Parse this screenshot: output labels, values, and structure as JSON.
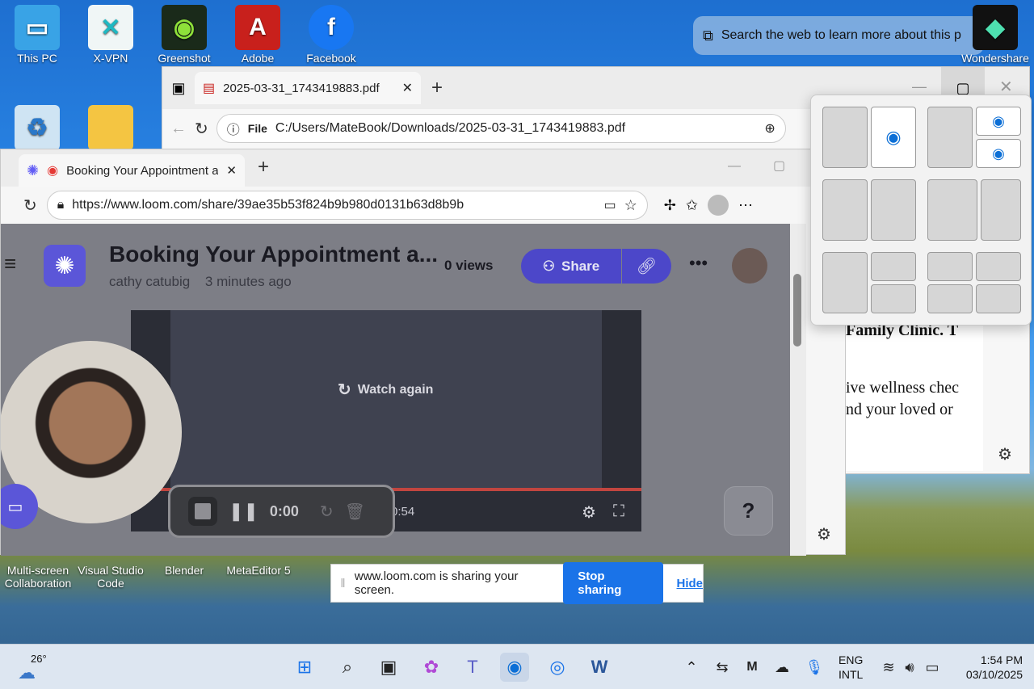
{
  "desktop_icons": [
    {
      "label": "This PC",
      "glyph": "🖥",
      "bg": "#39a3e6"
    },
    {
      "label": "X-VPN",
      "glyph": "✕",
      "bg": "#f0f6f6"
    },
    {
      "label": "Greenshot",
      "glyph": "◉",
      "bg": "#1a2a1a"
    },
    {
      "label": "Adobe",
      "glyph": "A",
      "bg": "#c8201c"
    },
    {
      "label": "Facebook",
      "glyph": "f",
      "bg": "#1877f2"
    },
    {
      "label": "Wondershare",
      "glyph": "◆",
      "bg": "#111"
    }
  ],
  "desktop_icons_bottom": [
    {
      "label": "Multi-screen Collaboration"
    },
    {
      "label": "Visual Studio Code"
    },
    {
      "label": "Blender"
    },
    {
      "label": "MetaEditor 5"
    }
  ],
  "search_pill": {
    "text": "Search the web to learn more about this p"
  },
  "pdf_window": {
    "tab_title": "2025-03-31_1743419883.pdf",
    "address_scheme": "File",
    "address": "C:/Users/MateBook/Downloads/2025-03-31_1743419883.pdf",
    "content_line1": "Family Clinic. T",
    "content_line2": "ive wellness chec",
    "content_line3": "nd your loved or"
  },
  "loom_window": {
    "tab_title": "Booking Your Appointment a",
    "address": "https://www.loom.com/share/39ae35b53f824b9b980d0131b63d8b9b",
    "video_title": "Booking Your Appointment a...",
    "author": "cathy catubig",
    "time_ago": "3 minutes ago",
    "views": "0 views",
    "share_label": "Share",
    "watch_again": "Watch again",
    "elapsed": "0:00",
    "duration": "0:54",
    "help": "?"
  },
  "share_banner": {
    "message": "www.loom.com is sharing your screen.",
    "stop_label": "Stop sharing",
    "hide_label": "Hide"
  },
  "taskbar": {
    "weather": "26°",
    "lang1": "ENG",
    "lang2": "INTL",
    "time": "1:54 PM",
    "date": "03/10/2025"
  },
  "colors": {
    "loom_purple": "#625df5",
    "edge_blue": "#0c6fd6",
    "stop_blue": "#1a73e8"
  }
}
